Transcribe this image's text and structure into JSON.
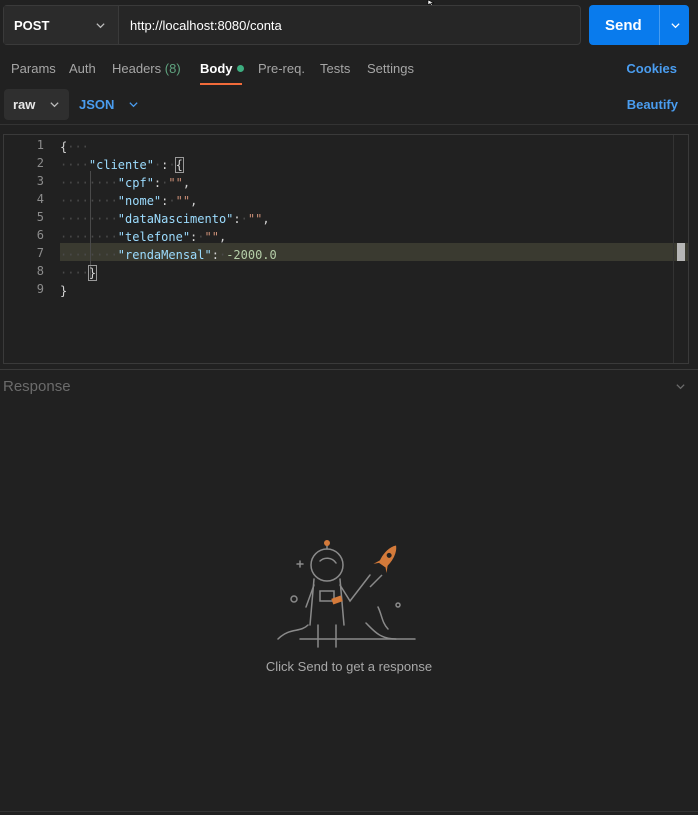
{
  "request": {
    "method": "POST",
    "url": "http://localhost:8080/conta",
    "send_label": "Send"
  },
  "tabs": [
    {
      "label": "Params"
    },
    {
      "label": "Auth"
    },
    {
      "label": "Headers",
      "count": "(8)"
    },
    {
      "label": "Body",
      "active": true
    },
    {
      "label": "Pre-req."
    },
    {
      "label": "Tests"
    },
    {
      "label": "Settings"
    }
  ],
  "cookies_label": "Cookies",
  "body_toolbar": {
    "mode": "raw",
    "format": "JSON",
    "beautify_label": "Beautify"
  },
  "editor": {
    "line_numbers": [
      "1",
      "2",
      "3",
      "4",
      "5",
      "6",
      "7",
      "8",
      "9"
    ],
    "highlighted_line": 7
  },
  "response": {
    "title": "Response",
    "empty_message": "Click Send to get a response"
  },
  "colors": {
    "accent_blue": "#097bed",
    "active_tab_underline": "#f26b3a",
    "body_dot": "#3dae80"
  }
}
